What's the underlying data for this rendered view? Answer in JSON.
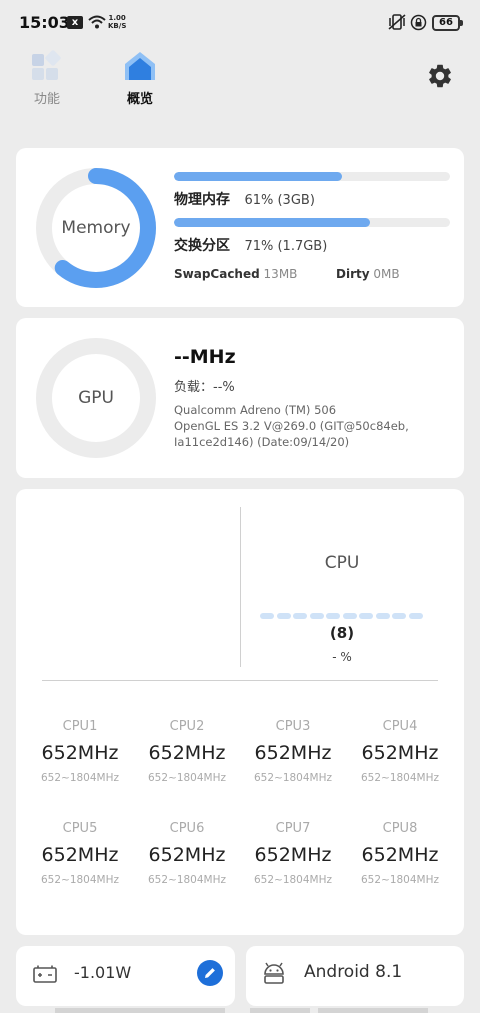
{
  "status_bar": {
    "time": "15:03",
    "notif": "x",
    "net_speed_value": "1.00",
    "net_speed_unit": "KB/S",
    "battery": "66"
  },
  "tabs": [
    {
      "label": "功能",
      "icon": "grid-icon"
    },
    {
      "label": "概览",
      "icon": "home-icon"
    }
  ],
  "settings_icon": "gear-icon",
  "accent_color": "#6ea9ef",
  "memory": {
    "title": "Memory",
    "ring_fraction": 0.61,
    "physical": {
      "label": "物理内存",
      "value": "61% (3GB)",
      "fraction": 0.61
    },
    "swap": {
      "label": "交换分区",
      "value": "71% (1.7GB)",
      "fraction": 0.71
    },
    "swap_cached": {
      "label": "SwapCached",
      "value": "13MB"
    },
    "dirty": {
      "label": "Dirty",
      "value": "0MB"
    }
  },
  "gpu": {
    "title": "GPU",
    "freq": "--MHz",
    "load": "负载：--%",
    "info_line1": "Qualcomm Adreno (TM) 506",
    "info_line2": "OpenGL ES 3.2 V@269.0 (GIT@50c84eb,",
    "info_line3": "Ia11ce2d146) (Date:09/14/20)"
  },
  "cpu": {
    "title": "CPU",
    "cores_count": "(8)",
    "load": "- %",
    "cores": [
      {
        "name": "CPU1",
        "freq": "652MHz",
        "range": "652~1804MHz"
      },
      {
        "name": "CPU2",
        "freq": "652MHz",
        "range": "652~1804MHz"
      },
      {
        "name": "CPU3",
        "freq": "652MHz",
        "range": "652~1804MHz"
      },
      {
        "name": "CPU4",
        "freq": "652MHz",
        "range": "652~1804MHz"
      },
      {
        "name": "CPU5",
        "freq": "652MHz",
        "range": "652~1804MHz"
      },
      {
        "name": "CPU6",
        "freq": "652MHz",
        "range": "652~1804MHz"
      },
      {
        "name": "CPU7",
        "freq": "652MHz",
        "range": "652~1804MHz"
      },
      {
        "name": "CPU8",
        "freq": "652MHz",
        "range": "652~1804MHz"
      }
    ]
  },
  "power": {
    "value": "-1.01W",
    "icon": "battery-icon",
    "edit_icon": "pencil-icon"
  },
  "android": {
    "label": "Android 8.1",
    "icon": "android-icon"
  }
}
